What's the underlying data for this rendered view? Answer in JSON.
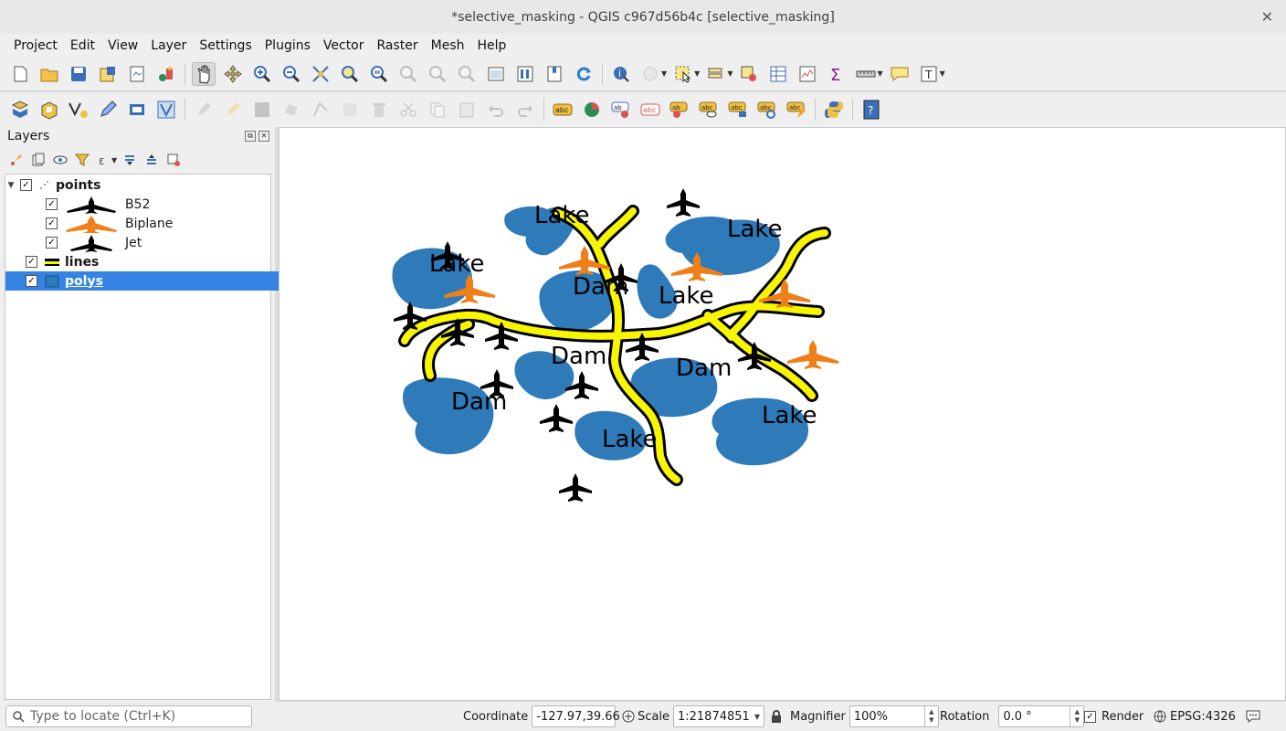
{
  "window": {
    "title": "*selective_masking - QGIS c967d56b4c [selective_masking]"
  },
  "menu": [
    "Project",
    "Edit",
    "View",
    "Layer",
    "Settings",
    "Plugins",
    "Vector",
    "Raster",
    "Mesh",
    "Help"
  ],
  "layers_panel": {
    "title": "Layers",
    "items": [
      {
        "label": "points",
        "checked": true,
        "expanded": true,
        "bold": true
      },
      {
        "label": "B52",
        "checked": true,
        "symbol_color": "#000000"
      },
      {
        "label": "Biplane",
        "checked": true,
        "symbol_color": "#f07f17"
      },
      {
        "label": "Jet",
        "checked": true,
        "symbol_color": "#000000"
      },
      {
        "label": "lines",
        "checked": true,
        "bold": true,
        "symbol_color": "#f7f600"
      },
      {
        "label": "polys",
        "checked": true,
        "bold": true,
        "selected": true,
        "symbol_color": "#2f7ab9"
      }
    ]
  },
  "map": {
    "background": "#ffffff",
    "lake_color": "#2f7ab9",
    "river_color": "#f7f600",
    "biplane_color": "#f07f17",
    "labels": [
      "Lake",
      "Lake",
      "Lake",
      "Lake",
      "Lake",
      "Lake",
      "Lake",
      "Dam",
      "Dam",
      "Dam",
      "Dam"
    ]
  },
  "statusbar": {
    "locate_placeholder": "Type to locate (Ctrl+K)",
    "coordinate_label": "Coordinate",
    "coordinate_value": "-127.97,39.66",
    "scale_label": "Scale",
    "scale_value": "1:21874851",
    "magnifier_label": "Magnifier",
    "magnifier_value": "100%",
    "rotation_label": "Rotation",
    "rotation_value": "0.0 °",
    "render_label": "Render",
    "render_checked": true,
    "crs_label": "EPSG:4326"
  }
}
